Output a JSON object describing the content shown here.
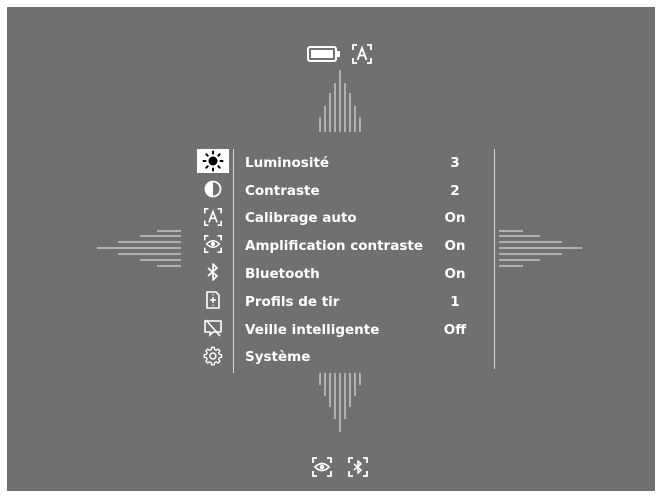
{
  "status_top": {
    "battery_icon": "battery-full-icon",
    "auto_calibration_icon": "auto-calibration-icon"
  },
  "menu": {
    "items": [
      {
        "icon": "brightness-icon",
        "label": "Luminosité",
        "value": "3",
        "selected": true
      },
      {
        "icon": "contrast-icon",
        "label": "Contraste",
        "value": "2",
        "selected": false
      },
      {
        "icon": "auto-calibration-icon",
        "label": "Calibrage auto",
        "value": "On",
        "selected": false
      },
      {
        "icon": "contrast-amplification-icon",
        "label": "Amplification contraste",
        "value": "On",
        "selected": false
      },
      {
        "icon": "bluetooth-icon",
        "label": "Bluetooth",
        "value": "On",
        "selected": false
      },
      {
        "icon": "shooting-profile-icon",
        "label": "Profils de tir",
        "value": "1",
        "selected": false
      },
      {
        "icon": "smart-standby-icon",
        "label": "Veille intelligente",
        "value": "Off",
        "selected": false
      },
      {
        "icon": "settings-gear-icon",
        "label": "Système",
        "value": "",
        "selected": false
      }
    ]
  },
  "status_bottom": {
    "amplification_icon": "contrast-amplification-icon",
    "bluetooth_icon": "bluetooth-framed-icon"
  },
  "colors": {
    "screen_bg": "#707070",
    "text": "#ffffff",
    "selected_bg": "#ffffff"
  }
}
